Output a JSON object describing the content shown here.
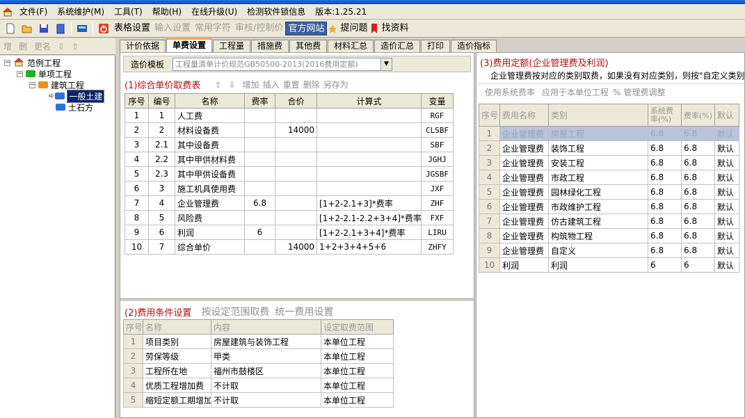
{
  "menu": {
    "items": [
      "文件(F)",
      "系统维护(M)",
      "工具(T)",
      "帮助(H)",
      "在线升级(U)",
      "检测软件锁信息",
      "版本:1.25.21"
    ]
  },
  "toolbar": {
    "table_settings": "表格设置",
    "input_settings": "输入设置",
    "common_chars": "常用字符",
    "review_control": "审核/控制价",
    "official_site": "官方网站",
    "ask_question": "提问题",
    "find_materials": "找资料"
  },
  "left_toolbar": {
    "add": "增",
    "delete": "删",
    "rename": "更名",
    "down": "⇩",
    "up": "⇧"
  },
  "tree": {
    "root": "范例工程",
    "single_item": "单项工程",
    "building": "建筑工程",
    "general_civil": "一般土建",
    "earthwork": "土石方"
  },
  "tabs": [
    "计价依据",
    "单费设置",
    "工程量",
    "措施费",
    "其他费",
    "材料汇总",
    "造价汇总",
    "打印",
    "造价指标"
  ],
  "template": {
    "label": "造价模板",
    "value": "工程量清单计价规范GB50500-2013(2016费用定额)"
  },
  "section1": {
    "title": "(1)综合单价取费表",
    "actions": [
      "⇧",
      "⇩",
      "增加",
      "插入",
      "重置",
      "删除",
      "另存为"
    ],
    "headers": [
      "序号",
      "编号",
      "名称",
      "费率",
      "合价",
      "计算式",
      "变量"
    ],
    "rows": [
      [
        "1",
        "1",
        "人工费",
        "",
        "",
        "",
        "RGF"
      ],
      [
        "2",
        "2",
        "材料设备费",
        "",
        "14000",
        "",
        "CLSBF"
      ],
      [
        "3",
        "2.1",
        "其中设备费",
        "",
        "",
        "",
        "SBF"
      ],
      [
        "4",
        "2.2",
        "其中甲供材料费",
        "",
        "",
        "",
        "JGHJ"
      ],
      [
        "5",
        "2.3",
        "其中甲供设备费",
        "",
        "",
        "",
        "JGSBF"
      ],
      [
        "6",
        "3",
        "施工机具使用费",
        "",
        "",
        "",
        "JXF"
      ],
      [
        "7",
        "4",
        "企业管理费",
        "6.8",
        "",
        "[1+2-2.1+3]*费率",
        "ZHF"
      ],
      [
        "8",
        "5",
        "风险费",
        "",
        "",
        "[1+2-2.1-2.2+3+4]*费率",
        "FXF"
      ],
      [
        "9",
        "6",
        "利润",
        "6",
        "",
        "[1+2-2.1+3+4]*费率",
        "LIRU"
      ],
      [
        "10",
        "7",
        "综合单价",
        "",
        "14000",
        "1+2+3+4+5+6",
        "ZHFY"
      ]
    ]
  },
  "section2": {
    "title": "(2)费用条件设置",
    "action1": "按设定范围取费",
    "action2": "统一费用设置",
    "headers": [
      "序号",
      "名称",
      "内容",
      "设定取费范围"
    ],
    "rows": [
      [
        "1",
        "项目类别",
        "房屋建筑与装饰工程",
        "本单位工程"
      ],
      [
        "2",
        "劳保等级",
        "甲类",
        "本单位工程"
      ],
      [
        "3",
        "工程所在地",
        "福州市鼓楼区",
        "本单位工程"
      ],
      [
        "4",
        "优质工程增加费",
        "不计取",
        "本单位工程"
      ],
      [
        "5",
        "缩短定额工期增加",
        "不计取",
        "本单位工程"
      ]
    ]
  },
  "section3": {
    "title": "(3)费用定额(企业管理费及利润)",
    "note": "企业管理费按对应的类别取费，如果没有对应类别，则按\"自定义类别",
    "actions": [
      "使用系统费率",
      "应用于本单位工程",
      "%",
      "管理费调整"
    ],
    "headers": [
      "序号",
      "费用名称",
      "类别",
      "系统费率(%)",
      "费率(%)",
      "默认"
    ],
    "rows": [
      [
        "1",
        "企业管理费",
        "房屋工程",
        "6.8",
        "6.8",
        "默认"
      ],
      [
        "2",
        "企业管理费",
        "装饰工程",
        "6.8",
        "6.8",
        "默认"
      ],
      [
        "3",
        "企业管理费",
        "安装工程",
        "6.8",
        "6.8",
        "默认"
      ],
      [
        "4",
        "企业管理费",
        "市政工程",
        "6.8",
        "6.8",
        "默认"
      ],
      [
        "5",
        "企业管理费",
        "园林绿化工程",
        "6.8",
        "6.8",
        "默认"
      ],
      [
        "6",
        "企业管理费",
        "市政维护工程",
        "6.8",
        "6.8",
        "默认"
      ],
      [
        "7",
        "企业管理费",
        "仿古建筑工程",
        "6.8",
        "6.8",
        "默认"
      ],
      [
        "8",
        "企业管理费",
        "构筑物工程",
        "6.8",
        "6.8",
        "默认"
      ],
      [
        "9",
        "企业管理费",
        "自定义",
        "6.8",
        "6.8",
        "默认"
      ],
      [
        "10",
        "利润",
        "利润",
        "6",
        "6",
        "默认"
      ]
    ]
  },
  "colors": {
    "accent": "#b01010",
    "selection": "#0a246a",
    "chrome": "#ece9d8"
  }
}
